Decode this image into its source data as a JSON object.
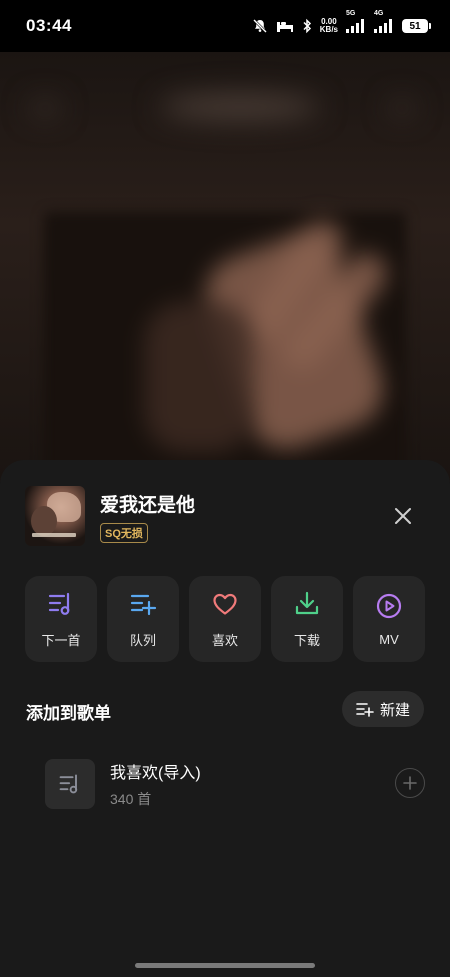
{
  "status": {
    "time": "03:44",
    "net_speed_value": "0.00",
    "net_speed_unit": "KB/s",
    "signal1_tag": "5G",
    "signal2_tag": "4G",
    "battery": "51"
  },
  "song": {
    "title": "爱我还是他",
    "quality": "SQ无损"
  },
  "actions": [
    {
      "label": "下一首",
      "icon": "play-next-icon",
      "color": "#8f7cf0"
    },
    {
      "label": "队列",
      "icon": "add-to-queue-icon",
      "color": "#5aa8f0"
    },
    {
      "label": "喜欢",
      "icon": "heart-icon",
      "color": "#f07a7a"
    },
    {
      "label": "下载",
      "icon": "download-icon",
      "color": "#4fd08a"
    },
    {
      "label": "MV",
      "icon": "mv-play-icon",
      "color": "#b77cf0"
    }
  ],
  "playlist_section": {
    "title": "添加到歌单",
    "new_label": "新建"
  },
  "playlists": [
    {
      "name": "我喜欢(导入)",
      "count": "340 首"
    }
  ]
}
